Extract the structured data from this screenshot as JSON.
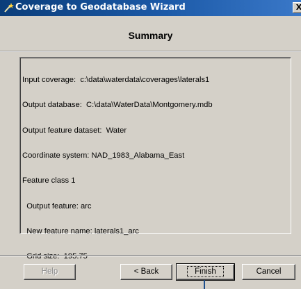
{
  "window": {
    "title": "Coverage to Geodatabase Wizard",
    "close_glyph": "X",
    "icon": "wizard-wand-icon"
  },
  "heading": "Summary",
  "summary_lines": [
    "Input coverage:  c:\\data\\waterdata\\coverages\\laterals1",
    "Output database:  C:\\data\\WaterData\\Montgomery.mdb",
    "Output feature dataset:  Water",
    "Coordinate system: NAD_1983_Alabama_East",
    "Feature class 1",
    "  Output feature: arc",
    "  New feature name: laterals1_arc",
    "  Grid size:  195.75"
  ],
  "buttons": {
    "help": "Help",
    "back": "< Back",
    "finish": "Finish",
    "cancel": "Cancel"
  },
  "colors": {
    "titlebar": "#0a3d7a",
    "face": "#d4d0c8",
    "pointer": "#1c4e8c"
  }
}
